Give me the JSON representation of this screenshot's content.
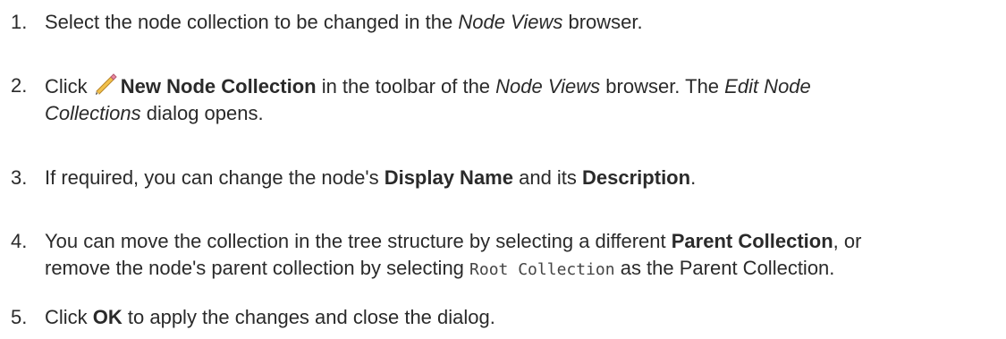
{
  "steps": [
    {
      "num": "1.",
      "parts": [
        "Select the node collection to be changed in the ",
        "Node Views",
        " browser."
      ]
    },
    {
      "num": "2.",
      "parts": [
        "Click ",
        "New Node Collection",
        " in the toolbar of the ",
        "Node Views",
        " browser. The ",
        "Edit Node",
        "Collections",
        " dialog opens."
      ],
      "icon": "pencil-icon"
    },
    {
      "num": "3.",
      "parts": [
        "If required, you can change the node's ",
        "Display Name",
        " and its ",
        "Description",
        "."
      ]
    },
    {
      "num": "4.",
      "parts": [
        "You can move the collection in the tree structure by selecting a different ",
        "Parent Collection",
        ", or",
        "remove the node's parent collection by selecting ",
        "Root Collection",
        " as the Parent Collection."
      ]
    },
    {
      "num": "5.",
      "parts": [
        "Click ",
        "OK",
        " to apply the changes and close the dialog."
      ]
    }
  ]
}
